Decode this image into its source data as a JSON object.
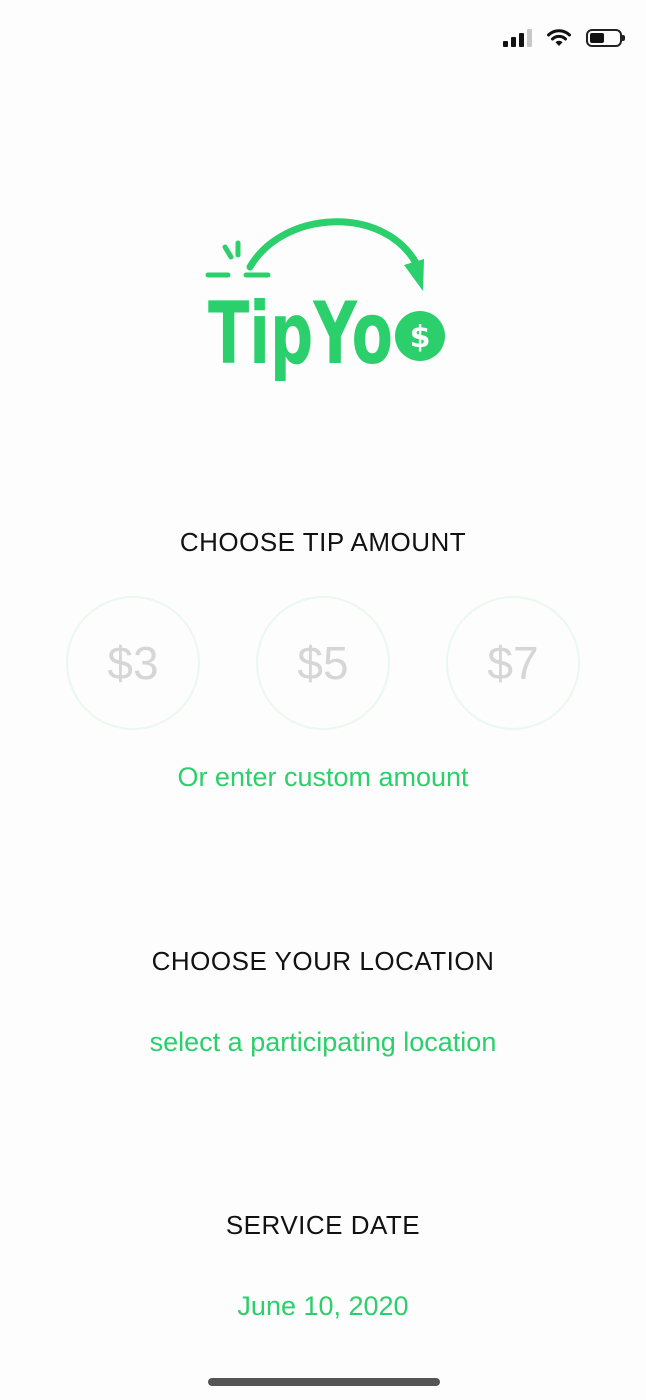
{
  "status_bar": {
    "signal_icon": "cellular-signal-icon",
    "wifi_icon": "wifi-icon",
    "battery_icon": "battery-icon",
    "battery_level": 0.5
  },
  "logo": {
    "text": "TipYo",
    "currency_symbol": "$",
    "brand_color": "#2bcf6b"
  },
  "tip_section": {
    "title": "CHOOSE TIP AMOUNT",
    "amounts": [
      "$3",
      "$5",
      "$7"
    ],
    "custom_amount_link": "Or enter custom amount"
  },
  "location_section": {
    "title": "CHOOSE YOUR LOCATION",
    "select_link": "select a participating location"
  },
  "date_section": {
    "title": "SERVICE DATE",
    "value": "June 10, 2020"
  },
  "colors": {
    "accent": "#2bcf6b",
    "title_text": "#111111",
    "amount_text": "#d6d6d6",
    "circle_border": "#eaf8ef"
  }
}
